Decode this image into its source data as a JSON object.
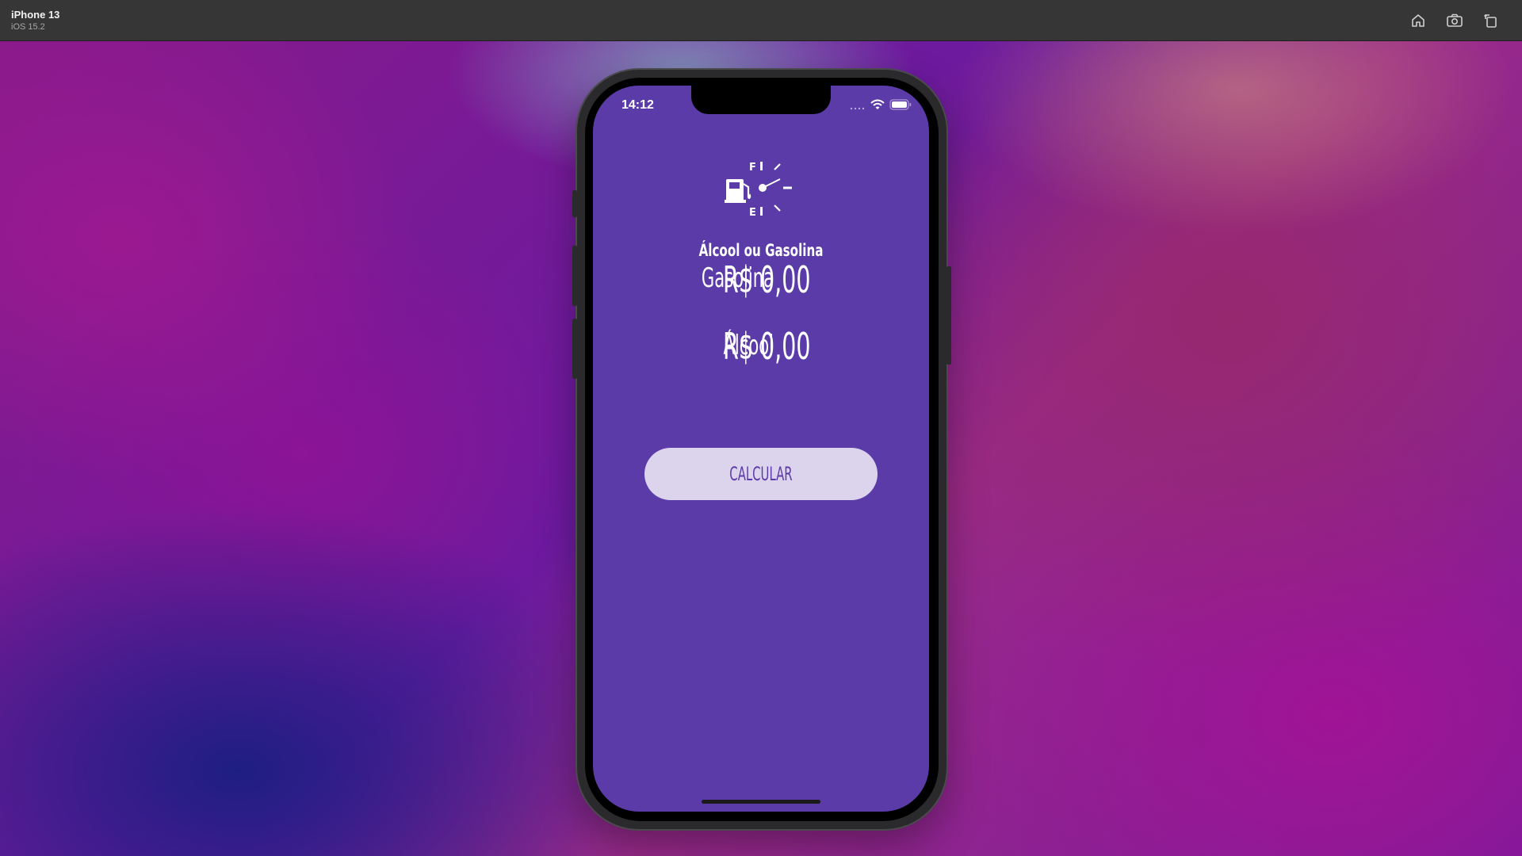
{
  "simulator": {
    "device_name": "iPhone 13",
    "os_version": "iOS 15.2",
    "toolbar": [
      "home-icon",
      "screenshot-icon",
      "rotate-icon"
    ]
  },
  "status_bar": {
    "time": "14:12"
  },
  "app": {
    "icon": "fuel-gauge-icon",
    "title": "Álcool ou Gasolina",
    "fields": [
      {
        "label": "Gasolina",
        "value": "R$ 0,00"
      },
      {
        "label": "Álcool",
        "value": "R$ 0,00"
      }
    ],
    "button_label": "CALCULAR"
  },
  "colors": {
    "screen_background": "#5a3ba8",
    "button_background": "#dcd3ec",
    "button_text": "#5a3ba8",
    "text": "#ffffff"
  }
}
